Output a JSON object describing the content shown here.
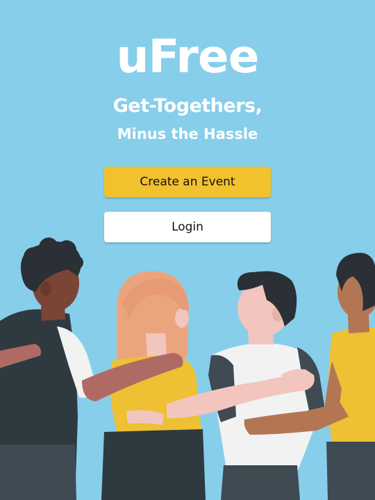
{
  "app": {
    "logo_text": "uFree",
    "tagline_line1": "Get-Togethers,",
    "tagline_line2": "Minus the Hassle"
  },
  "actions": {
    "create_label": "Create an Event",
    "login_label": "Login"
  },
  "colors": {
    "background": "#87CEEB",
    "primary_button": "#F2C12E",
    "secondary_button": "#FFFFFF",
    "text_on_background": "#FFFFFF",
    "button_text": "#111111"
  },
  "illustration": {
    "name": "group-of-friends-hugging"
  }
}
